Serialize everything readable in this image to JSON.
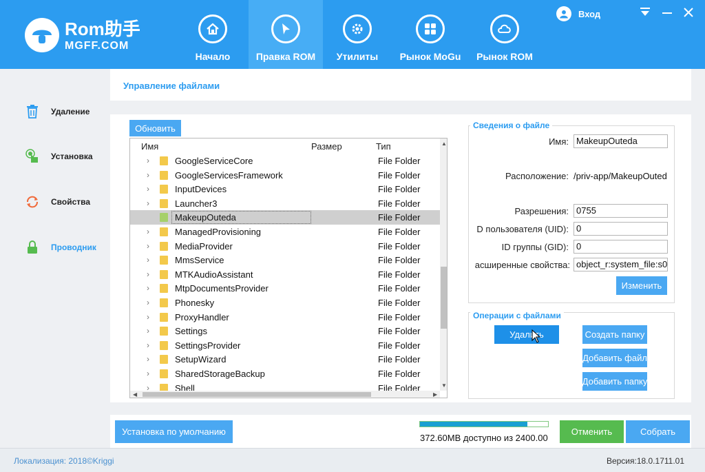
{
  "app": {
    "logo_main": "Rom助手",
    "logo_sub": "MGFF.COM",
    "login_label": "Вход"
  },
  "nav": [
    {
      "label": "Начало",
      "icon": "home-icon"
    },
    {
      "label": "Правка ROM",
      "icon": "cursor-icon"
    },
    {
      "label": "Утилиты",
      "icon": "gear-icon"
    },
    {
      "label": "Рынок MoGu",
      "icon": "grid-icon"
    },
    {
      "label": "Рынок ROM",
      "icon": "cloud-icon"
    }
  ],
  "sidebar": [
    {
      "label": "Удаление",
      "icon": "trash-icon"
    },
    {
      "label": "Установка",
      "icon": "install-icon"
    },
    {
      "label": "Свойства",
      "icon": "refresh-icon"
    },
    {
      "label": "Проводник",
      "icon": "lock-icon"
    }
  ],
  "page_title": "Управление файлами",
  "refresh_button": "Обновить",
  "file_list": {
    "headers": {
      "name": "Имя",
      "size": "Размер",
      "type": "Тип"
    },
    "rows": [
      {
        "name": "GoogleServiceCore",
        "type": "File Folder"
      },
      {
        "name": "GoogleServicesFramework",
        "type": "File Folder"
      },
      {
        "name": "InputDevices",
        "type": "File Folder"
      },
      {
        "name": "Launcher3",
        "type": "File Folder"
      },
      {
        "name": "MakeupOuteda",
        "type": "File Folder",
        "selected": true
      },
      {
        "name": "ManagedProvisioning",
        "type": "File Folder"
      },
      {
        "name": "MediaProvider",
        "type": "File Folder"
      },
      {
        "name": "MmsService",
        "type": "File Folder"
      },
      {
        "name": "MTKAudioAssistant",
        "type": "File Folder"
      },
      {
        "name": "MtpDocumentsProvider",
        "type": "File Folder"
      },
      {
        "name": "Phonesky",
        "type": "File Folder"
      },
      {
        "name": "ProxyHandler",
        "type": "File Folder"
      },
      {
        "name": "Settings",
        "type": "File Folder"
      },
      {
        "name": "SettingsProvider",
        "type": "File Folder"
      },
      {
        "name": "SetupWizard",
        "type": "File Folder"
      },
      {
        "name": "SharedStorageBackup",
        "type": "File Folder"
      },
      {
        "name": "Shell",
        "type": "File Folder"
      }
    ]
  },
  "file_info": {
    "title": "Сведения о файле",
    "name_label": "Имя:",
    "name_value": "MakeupOuteda",
    "location_label": "Расположение:",
    "location_value": "/priv-app/MakeupOuted",
    "perm_label": "Разрешения:",
    "perm_value": "0755",
    "uid_label": "D пользователя (UID):",
    "uid_value": "0",
    "gid_label": "ID группы (GID):",
    "gid_value": "0",
    "ext_label": "асширенные свойства:",
    "ext_value": "object_r:system_file:s0",
    "change_button": "Изменить"
  },
  "file_ops": {
    "title": "Операции с файлами",
    "delete_button": "Удалить",
    "create_folder_button": "Создать папку",
    "add_file_button": "Добавить файл",
    "add_folder_button": "Добавить папку"
  },
  "bottom": {
    "default_install_button": "Установка по умолчанию",
    "storage_text": "372.60MB доступно из 2400.00",
    "progress": 0.84,
    "cancel_button": "Отменить",
    "build_button": "Собрать"
  },
  "status": {
    "left": "Локализация: 2018©Kriggi",
    "right": "Версия:18.0.1711.01"
  },
  "colors": {
    "accent": "#2c9cf0",
    "button": "#4aa8f2",
    "green": "#56bb4f"
  }
}
